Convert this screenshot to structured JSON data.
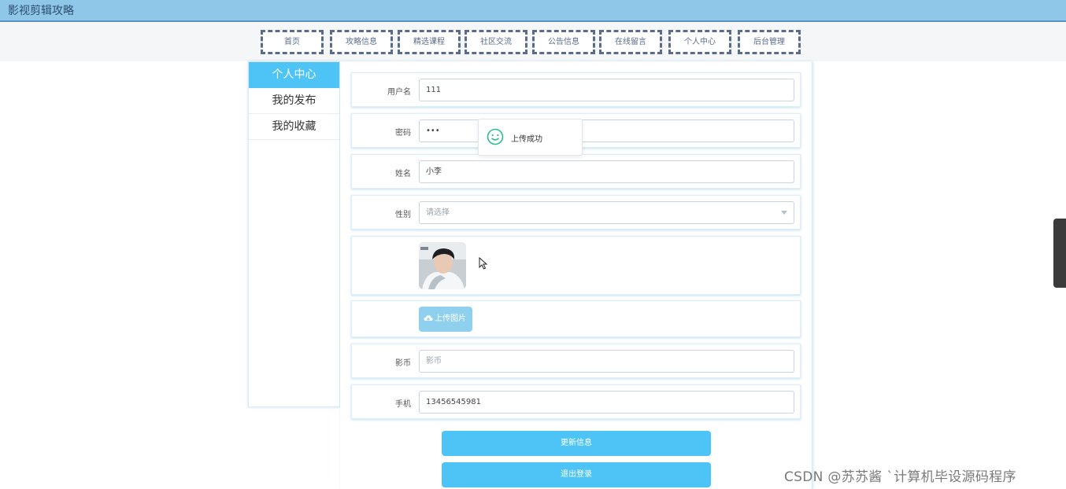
{
  "app": {
    "title": "影视剪辑攻略"
  },
  "nav": {
    "items": [
      {
        "label": "首页"
      },
      {
        "label": "攻略信息"
      },
      {
        "label": "精选课程"
      },
      {
        "label": "社区交流"
      },
      {
        "label": "公告信息"
      },
      {
        "label": "在线留言"
      },
      {
        "label": "个人中心"
      },
      {
        "label": "后台管理"
      }
    ]
  },
  "sidebar": {
    "items": [
      {
        "label": "个人中心",
        "active": true
      },
      {
        "label": "我的发布",
        "active": false
      },
      {
        "label": "我的收藏",
        "active": false
      }
    ]
  },
  "form": {
    "username": {
      "label": "用户名",
      "value": "111"
    },
    "password": {
      "label": "密码",
      "value": "•••"
    },
    "name": {
      "label": "姓名",
      "value": "小李"
    },
    "gender": {
      "label": "性别",
      "placeholder": "请选择"
    },
    "upload": {
      "label": "上传图片",
      "icon": "cloud-upload-icon"
    },
    "coins": {
      "label": "影币",
      "placeholder": "影币"
    },
    "phone": {
      "label": "手机",
      "value": "13456545981"
    }
  },
  "actions": {
    "update": "更新信息",
    "logout": "退出登录"
  },
  "toast": {
    "message": "上传成功",
    "icon": "smile-icon",
    "color": "#2bbf8f"
  },
  "watermark": "CSDN @苏苏酱    `计算机毕设源码程序",
  "colors": {
    "accent": "#4dc4f5",
    "topbar": "#8ec7e8",
    "nav_border": "#5a6c8c"
  }
}
